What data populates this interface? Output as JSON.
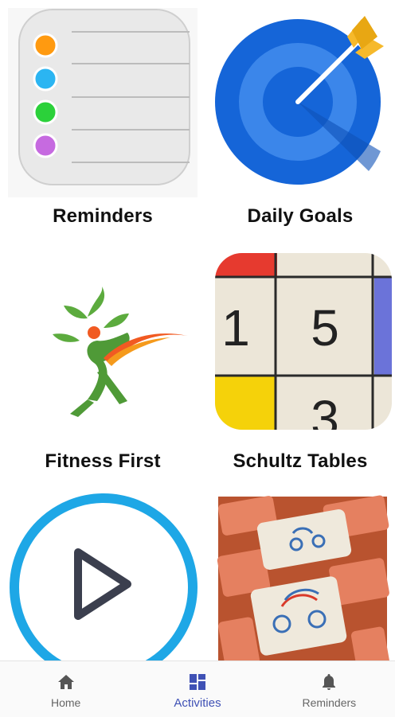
{
  "activities": [
    {
      "title": "Reminders",
      "icon": "reminders-list-icon"
    },
    {
      "title": "Daily Goals",
      "icon": "target-arrow-icon"
    },
    {
      "title": "Fitness First",
      "icon": "fitness-figure-icon"
    },
    {
      "title": "Schultz Tables",
      "icon": "schultz-table-icon"
    },
    {
      "title": "",
      "icon": "play-circle-icon"
    },
    {
      "title": "",
      "icon": "memory-cards-icon"
    }
  ],
  "schultz_numbers": [
    "1",
    "5",
    "3"
  ],
  "nav": {
    "home": {
      "label": "Home",
      "icon": "home-icon"
    },
    "activities": {
      "label": "Activities",
      "icon": "dashboard-icon",
      "active": true
    },
    "reminders": {
      "label": "Reminders",
      "icon": "bell-icon"
    }
  },
  "colors": {
    "accent": "#3f51b5",
    "nav_inactive": "#666666",
    "target_blue": "#1565d8",
    "play_ring": "#1ea7e6"
  }
}
